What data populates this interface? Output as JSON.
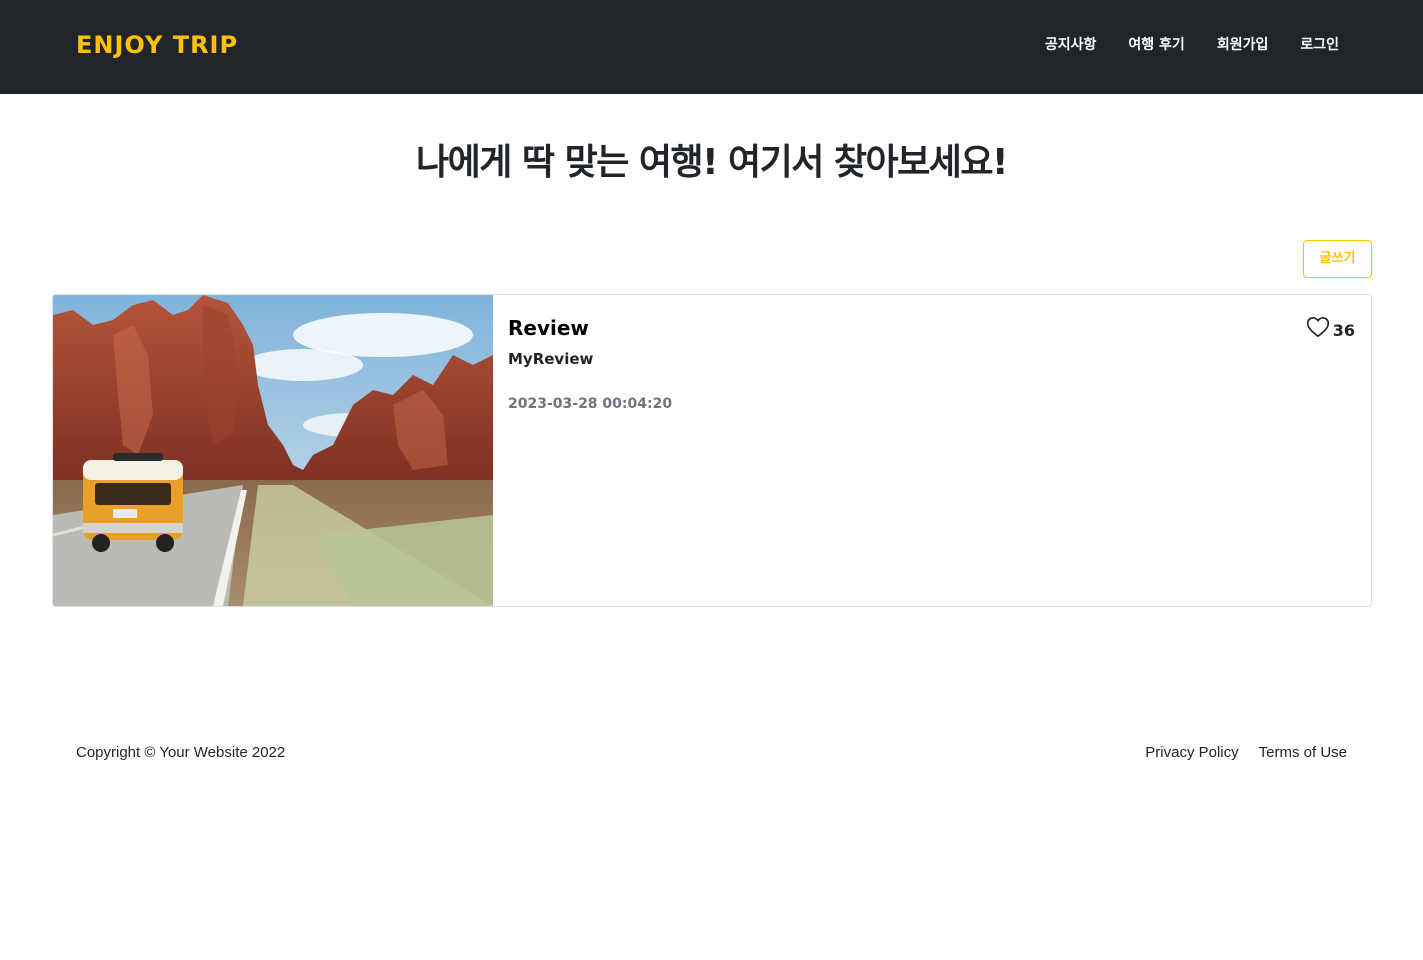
{
  "navbar": {
    "brand": "ENJOY TRIP",
    "links": [
      "공지사항",
      "여행 후기",
      "회원가입",
      "로그인"
    ]
  },
  "hero": {
    "title": "나에게 딱 맞는 여행! 여기서 찾아보세요!"
  },
  "toolbar": {
    "write_label": "글쓰기"
  },
  "review": {
    "title": "Review",
    "subtitle": "MyReview",
    "date": "2023-03-28 00:04:20",
    "likes": "36",
    "image_icon": "desert-road-van-photo"
  },
  "footer": {
    "copyright": "Copyright © Your Website 2022",
    "privacy": "Privacy Policy",
    "terms": "Terms of Use"
  },
  "colors": {
    "navbar_bg": "#212529",
    "accent": "#ffc107",
    "muted": "#6c757d",
    "border": "#dee2e6"
  }
}
